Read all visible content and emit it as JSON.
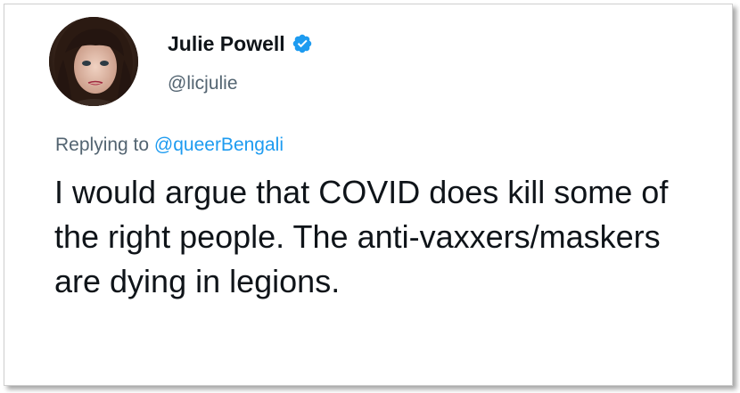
{
  "tweet": {
    "author": {
      "display_name": "Julie Powell",
      "handle": "@licjulie",
      "verified": true,
      "verified_icon": "verified-badge-icon",
      "avatar": "profile-photo"
    },
    "reply_prefix": "Replying to",
    "reply_to": "@queerBengali",
    "text": "I would argue that COVID does kill some of the right people. The anti-vaxxers/maskers are dying in legions."
  },
  "colors": {
    "text_primary": "#0f1419",
    "text_secondary": "#536471",
    "accent": "#1d9bf0"
  }
}
